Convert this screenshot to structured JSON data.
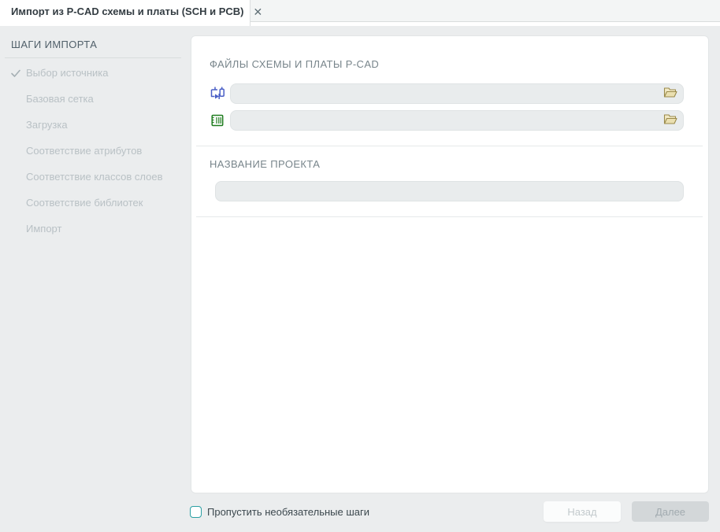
{
  "tab": {
    "title": "Импорт из P-CAD схемы и платы (SCH и PCB)",
    "close_icon": "✕"
  },
  "sidebar": {
    "title": "ШАГИ ИМПОРТА",
    "steps": [
      {
        "label": "Выбор источника",
        "checked": true
      },
      {
        "label": "Базовая сетка",
        "checked": false
      },
      {
        "label": "Загрузка",
        "checked": false
      },
      {
        "label": "Соответствие атрибутов",
        "checked": false
      },
      {
        "label": "Соответствие классов слоев",
        "checked": false
      },
      {
        "label": "Соответствие библиотек",
        "checked": false
      },
      {
        "label": "Импорт",
        "checked": false
      }
    ]
  },
  "main": {
    "files_section": {
      "title": "ФАЙЛЫ СХЕМЫ И ПЛАТЫ P-CAD",
      "sch_icon": "schematic-icon",
      "pcb_icon": "pcb-board-icon",
      "sch_value": "",
      "pcb_value": "",
      "browse_icon": "open-folder-icon"
    },
    "project_section": {
      "title": "НАЗВАНИЕ ПРОЕКТА",
      "value": ""
    }
  },
  "footer": {
    "skip_label": "Пропустить необязательные шаги",
    "skip_checked": false,
    "back_label": "Назад",
    "next_label": "Далее"
  },
  "colors": {
    "page_background": "#ebedee",
    "card_background": "#ffffff",
    "input_background": "#e9eced",
    "checkbox_accent": "#2a9fa3",
    "schematic_icon_blue": "#4a5fc6",
    "pcb_icon_green": "#1f7d1f",
    "folder_icon_tan": "#9a8a4a",
    "step_inactive_text": "#b9c1c5"
  }
}
